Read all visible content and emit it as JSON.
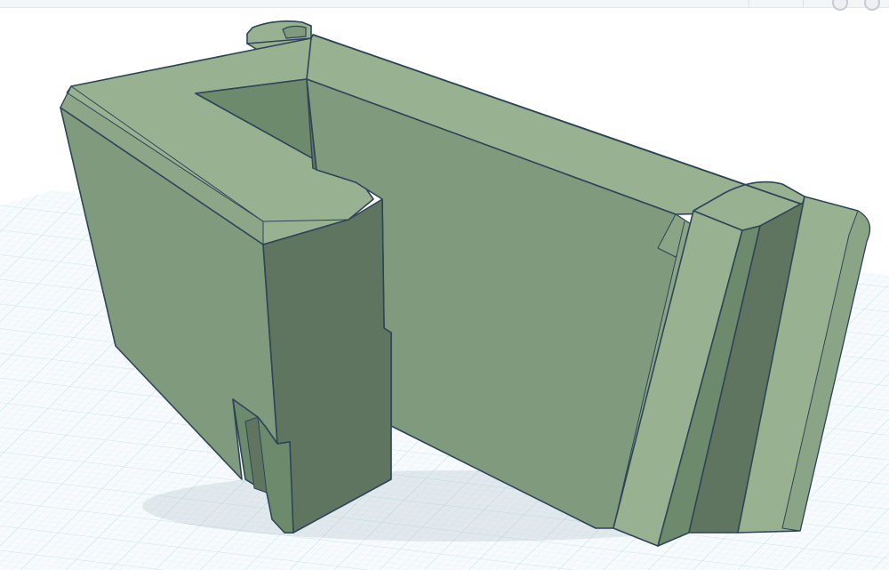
{
  "window": {
    "controls": [
      "view-cube-control",
      "home-view-control"
    ]
  },
  "workspace": {
    "background_color": "#ffffff",
    "grid_color": "#cfe6ee",
    "grid_major_color": "#a9d3e2",
    "model_color": "#7f9a7c",
    "model_top_color": "#98b291",
    "model_shadow_color": "#5f7560",
    "outline_color": "#2e4457"
  }
}
